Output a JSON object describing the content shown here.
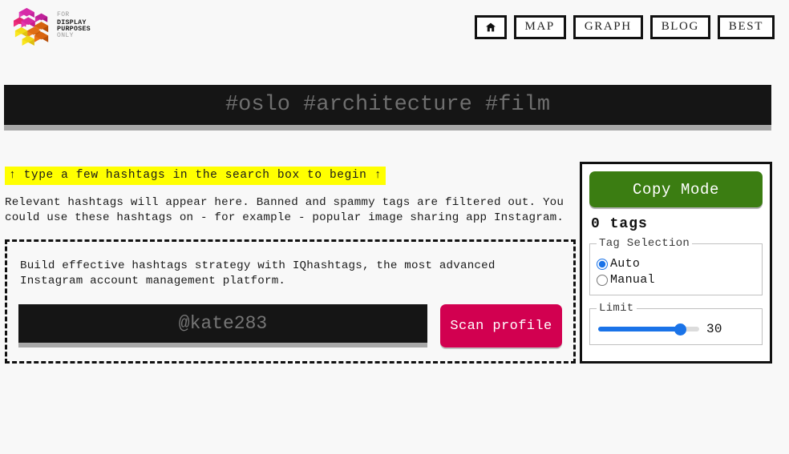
{
  "header": {
    "logo": {
      "icon": "isometric-cubes-logo",
      "line1": "FOR",
      "line2": "DISPLAY",
      "line3": "PURPOSES",
      "line4": "ONLY"
    },
    "nav": [
      {
        "label": "",
        "icon": "home-icon",
        "name": "nav-home"
      },
      {
        "label": "MAP",
        "icon": "",
        "name": "nav-map"
      },
      {
        "label": "GRAPH",
        "icon": "",
        "name": "nav-graph"
      },
      {
        "label": "BLOG",
        "icon": "",
        "name": "nav-blog"
      },
      {
        "label": "BEST",
        "icon": "",
        "name": "nav-best"
      }
    ]
  },
  "search": {
    "value": "",
    "placeholder": "#oslo #architecture #film"
  },
  "main": {
    "hint": "↑ type a few hashtags in the search box to begin ↑",
    "blurb": "Relevant hashtags will appear here. Banned and spammy tags are filtered out. You could use these hashtags on - for example - popular image sharing app Instagram.",
    "promo": {
      "text": "Build effective hashtags strategy with IQhashtags, the most advanced Instagram account management platform.",
      "profile_value": "",
      "profile_placeholder": "@kate283",
      "scan_label": "Scan profile"
    }
  },
  "panel": {
    "copy_mode_label": "Copy Mode",
    "tag_count": "0 tags",
    "tag_selection": {
      "legend": "Tag Selection",
      "options": [
        {
          "label": "Auto",
          "checked": true
        },
        {
          "label": "Manual",
          "checked": false
        }
      ]
    },
    "limit": {
      "legend": "Limit",
      "value": "30",
      "min": "1",
      "max": "35",
      "current": "30"
    }
  },
  "colors": {
    "background": "#f8f8f8",
    "search_bg": "#151515",
    "hint_highlight": "#ffff00",
    "copy_mode_green": "#3b7d12",
    "scan_pink": "#d20050",
    "slider_blue": "#1a73e8",
    "border_black": "#111111"
  }
}
